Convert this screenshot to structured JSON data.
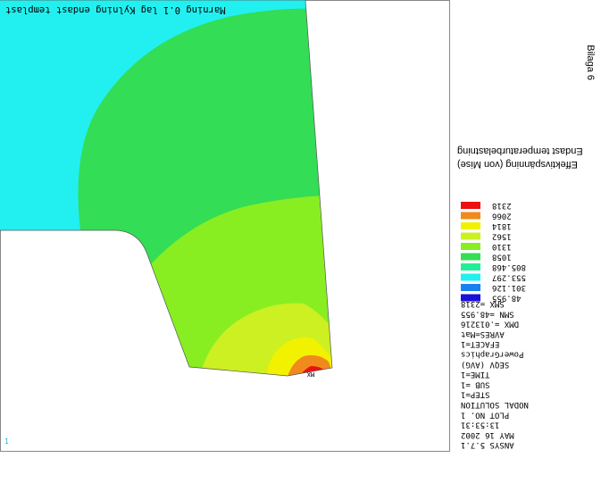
{
  "header_text": "Marning 0.1 lag Kylning endast templast",
  "corner_label": "1",
  "min_marker": "MX",
  "side_title": "Bilaga 6",
  "plot_title_line1": "Endast temperaturbelastning",
  "plot_title_line2": "Effektivspänning (von Mise)",
  "legend": {
    "entries": [
      {
        "value": "2318",
        "color": "#ee1111"
      },
      {
        "value": "2066",
        "color": "#f08a1c"
      },
      {
        "value": "1814",
        "color": "#f2f200"
      },
      {
        "value": "1562",
        "color": "#ccf022"
      },
      {
        "value": "1310",
        "color": "#88ee22"
      },
      {
        "value": "1058",
        "color": "#33dd55"
      },
      {
        "value": "805.468",
        "color": "#22ee99"
      },
      {
        "value": "553.297",
        "color": "#22f0f0"
      },
      {
        "value": "301.126",
        "color": "#1a80f0"
      },
      {
        "value": "48.955",
        "color": "#1a10d8"
      }
    ]
  },
  "info_lines": [
    "SMX =2318",
    "SMN =48.955",
    "DMX =.013216",
    "AVRES=Mat",
    "EFACET=1",
    "PowerGraphics",
    "SEQV      (AVG)",
    "TIME=1",
    "SUB =1",
    "STEP=1",
    "NODAL SOLUTION",
    "PLOT NO.    1",
    "13:53:31",
    "MAY 16 2002",
    "ANSYS 5.7.1"
  ],
  "colors": {
    "frame": "#888888",
    "cyan": "#22f0f0",
    "green": "#33dd55",
    "lime": "#88ee22",
    "yellowgreen": "#ccf022",
    "yellow": "#f2f200",
    "orange": "#f08a1c",
    "red": "#ee1111"
  }
}
